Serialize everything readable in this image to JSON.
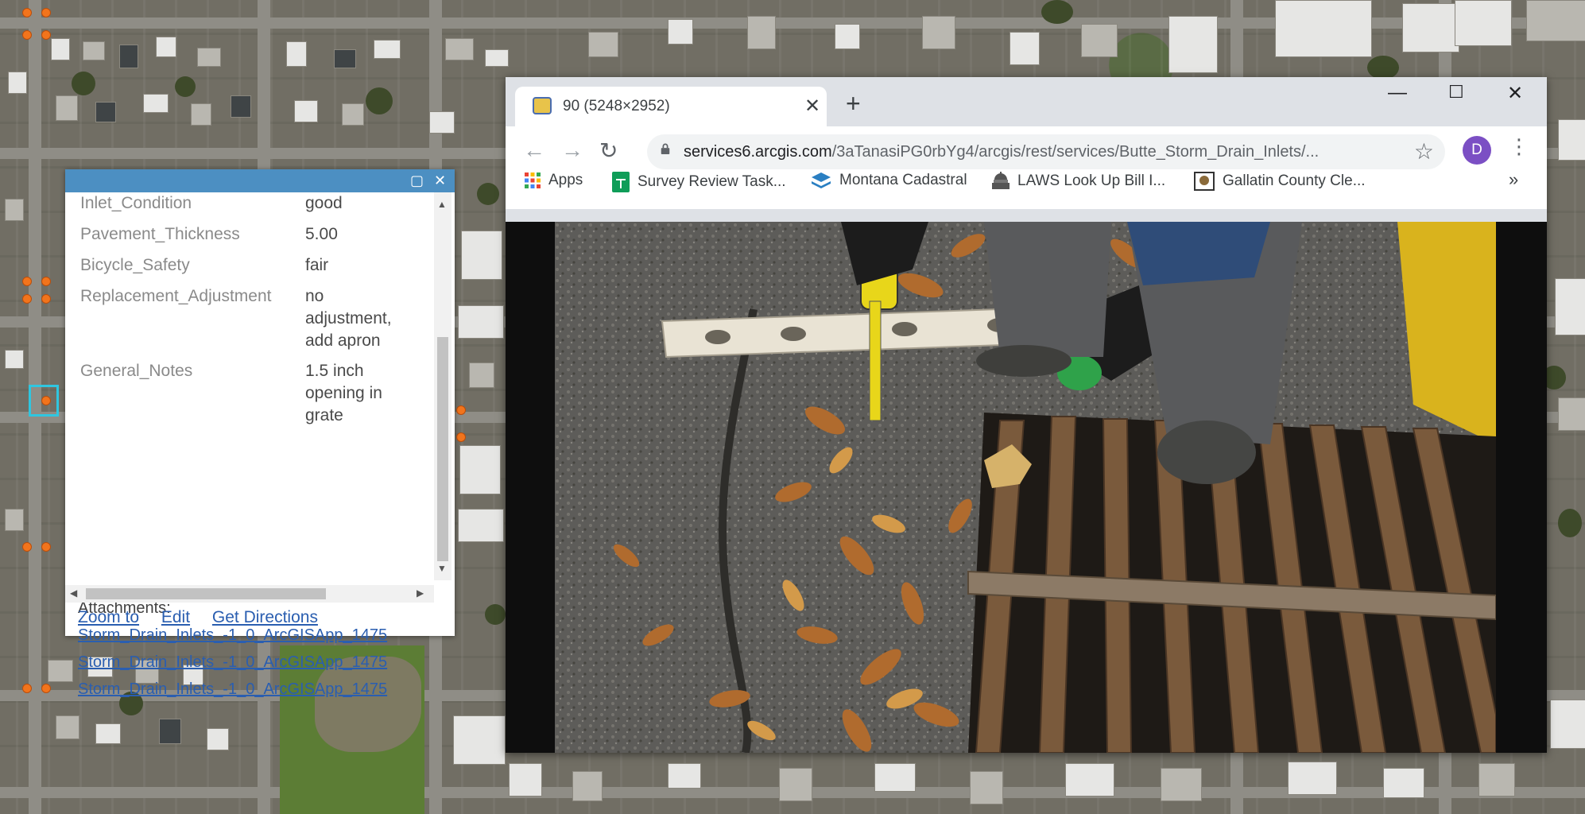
{
  "popup": {
    "fields": [
      {
        "name": "Inlet_Condition",
        "value": "good"
      },
      {
        "name": "Pavement_Thickness",
        "value": "5.00"
      },
      {
        "name": "Bicycle_Safety",
        "value": "fair"
      },
      {
        "name": "Replacement_Adjustment",
        "value_lines": [
          "no",
          "adjustment,",
          "add apron"
        ]
      },
      {
        "name": "General_Notes",
        "value_lines": [
          "1.5 inch",
          "opening in",
          "grate"
        ]
      }
    ],
    "attachments_label": "Attachments:",
    "attachments": [
      "Storm_Drain_Inlets_-1_0_ArcGISApp_1475",
      "Storm_Drain_Inlets_-1_0_ArcGISApp_1475",
      "Storm_Drain_Inlets_-1_0_ArcGISApp_1475"
    ],
    "actions": {
      "zoom": "Zoom to",
      "edit": "Edit",
      "directions": "Get Directions"
    },
    "header_color": "#4c8fc2"
  },
  "browser": {
    "tab_title": "90 (5248×2952)",
    "url_host": "services6.arcgis.com",
    "url_path": "/3aTanasiPG0rbYg4/arcgis/rest/services/Butte_Storm_Drain_Inlets/...",
    "profile_initial": "D",
    "bookmarks": [
      {
        "label": "Apps",
        "icon": "apps-grid-icon"
      },
      {
        "label": "Survey Review Task...",
        "icon": "sheets-icon"
      },
      {
        "label": "Montana Cadastral",
        "icon": "layers-icon"
      },
      {
        "label": "LAWS Look Up Bill I...",
        "icon": "capitol-icon"
      },
      {
        "label": "Gallatin County Cle...",
        "icon": "image-icon"
      }
    ],
    "more_bookmarks": "»"
  },
  "map": {
    "inlet_color": "#f2741c",
    "selection_color": "#2fc6e0"
  }
}
